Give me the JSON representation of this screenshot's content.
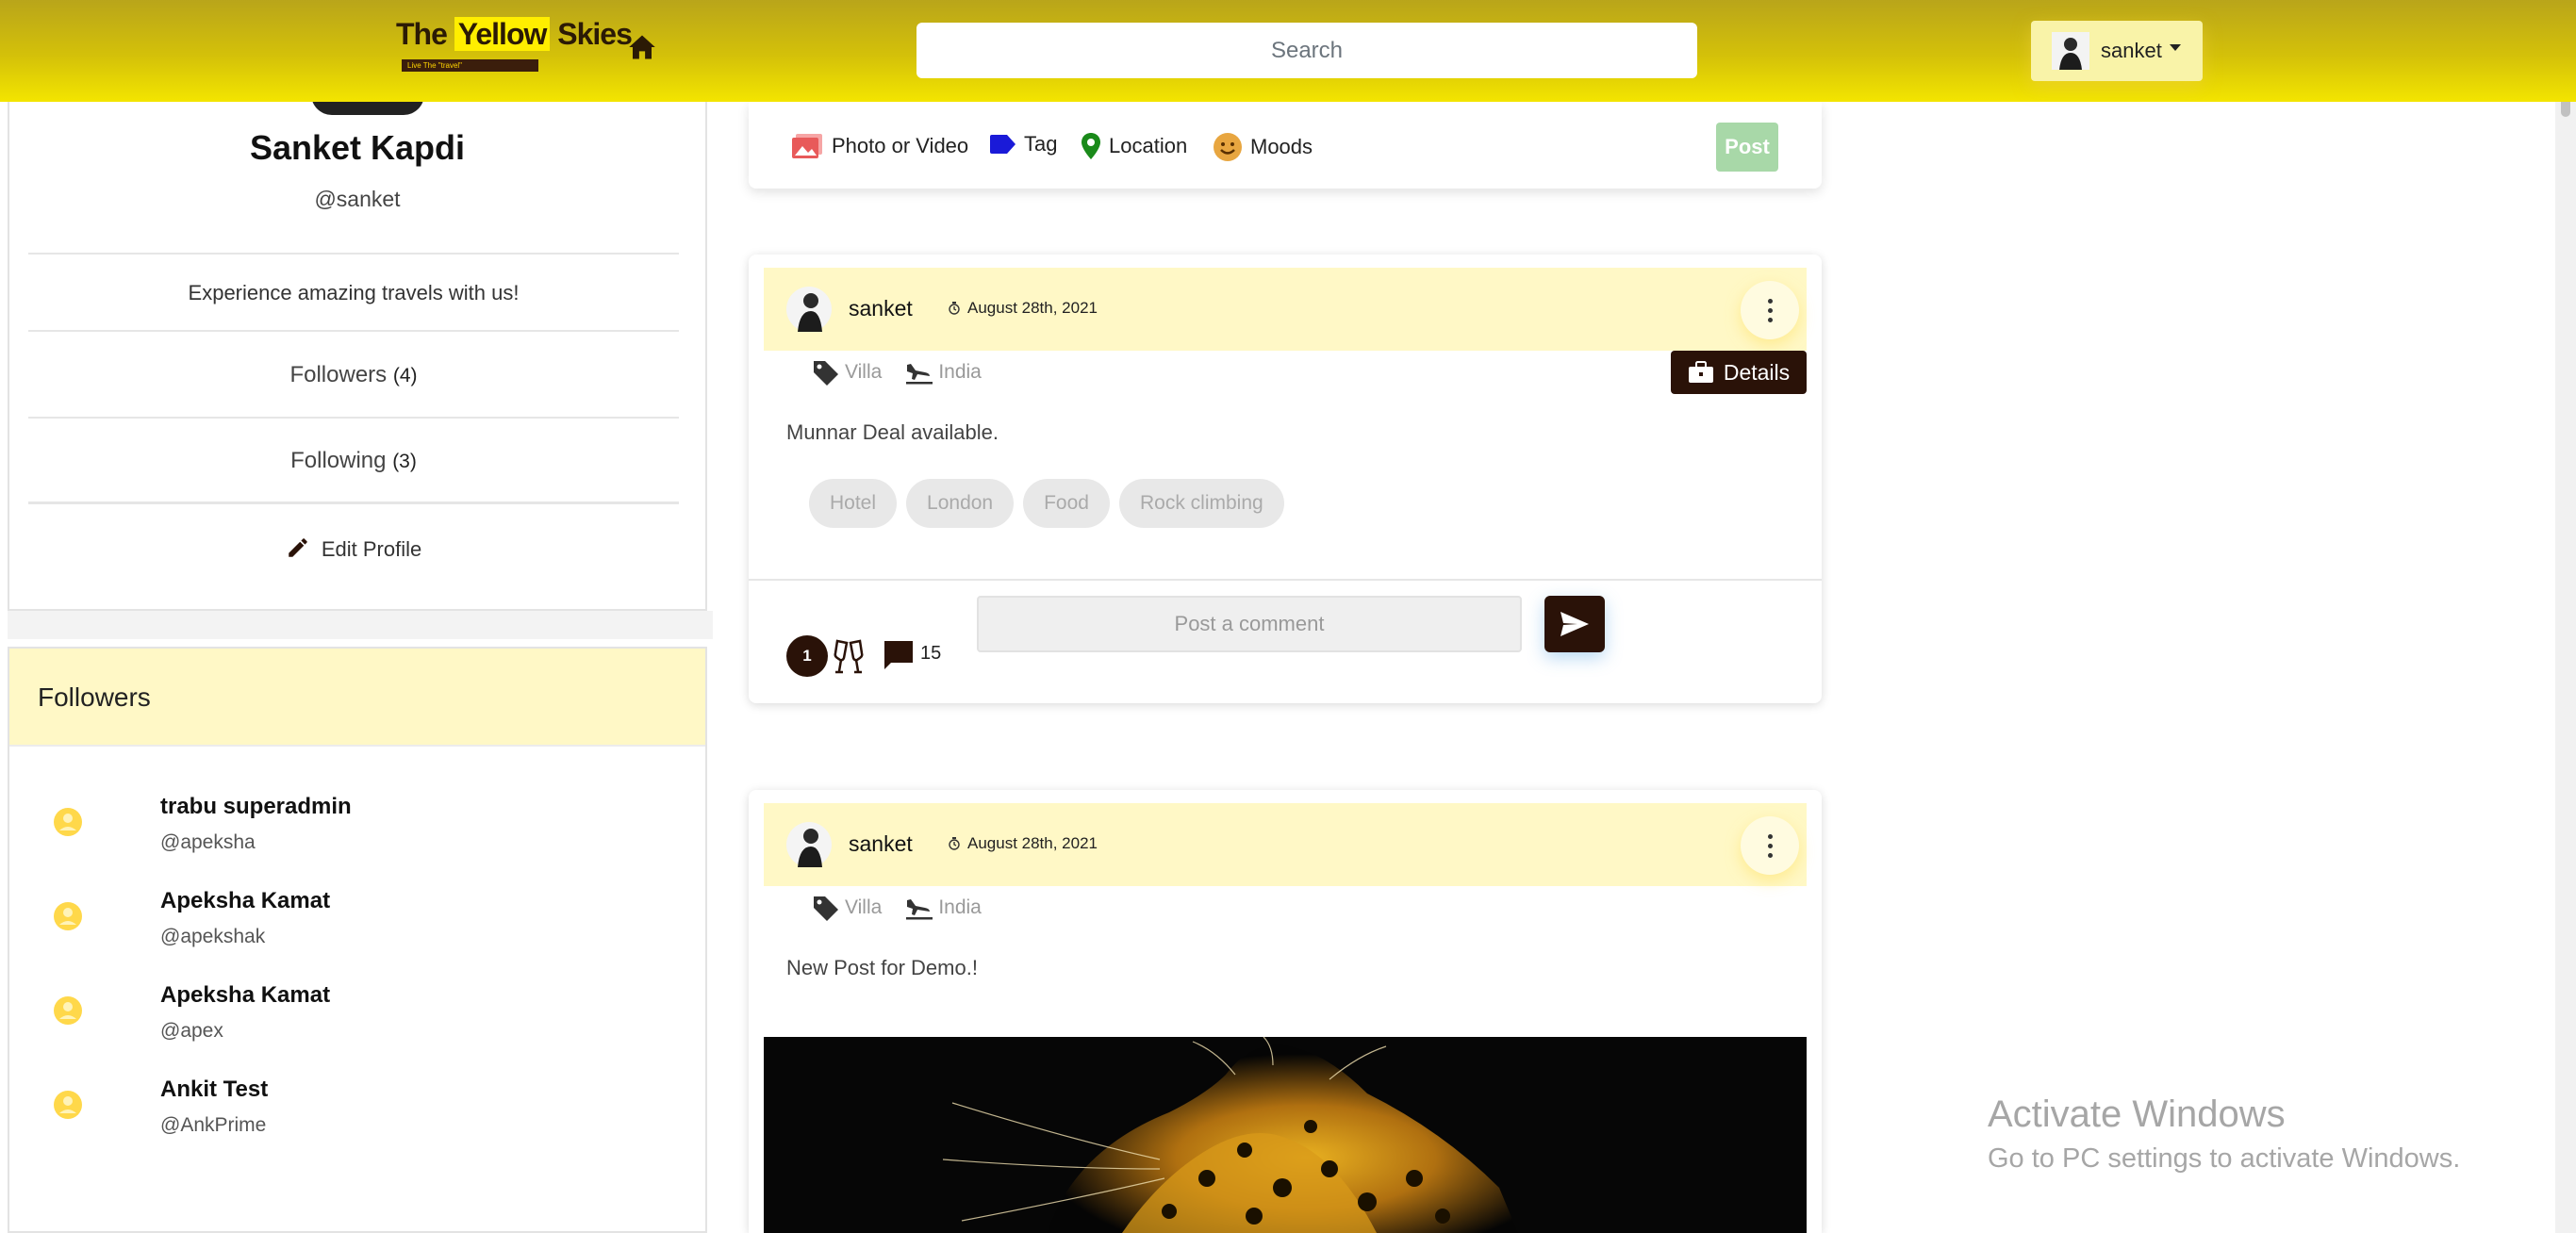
{
  "header": {
    "logo_part1": "The ",
    "logo_highlight": "Yellow",
    "logo_part2": " Skies",
    "logo_tagline": "Live The \"travel\"",
    "search_placeholder": "Search",
    "user_name": "sanket"
  },
  "profile": {
    "name": "Sanket Kapdi",
    "handle": "@sanket",
    "bio": "Experience amazing travels with us!",
    "followers_label": "Followers",
    "followers_count": "(4)",
    "following_label": "Following",
    "following_count": "(3)",
    "edit_label": "Edit Profile"
  },
  "followers": {
    "title": "Followers",
    "items": [
      {
        "name": "trabu superadmin",
        "handle": "@apeksha"
      },
      {
        "name": "Apeksha Kamat",
        "handle": "@apekshak"
      },
      {
        "name": "Apeksha Kamat",
        "handle": "@apex"
      },
      {
        "name": "Ankit Test",
        "handle": "@AnkPrime"
      }
    ]
  },
  "composer": {
    "photo_label": "Photo or Video",
    "tag_label": "Tag",
    "location_label": "Location",
    "moods_label": "Moods",
    "post_label": "Post"
  },
  "posts": [
    {
      "user": "sanket",
      "date": "August 28th, 2021",
      "tag": "Villa",
      "location": "India",
      "details_label": "Details",
      "text": "Munnar Deal available.",
      "tags": [
        "Hotel",
        "London",
        "Food",
        "Rock climbing"
      ],
      "likes": "1",
      "comments": "15",
      "comment_placeholder": "Post a comment"
    },
    {
      "user": "sanket",
      "date": "August 28th, 2021",
      "tag": "Villa",
      "location": "India",
      "text": "New Post for Demo.!"
    }
  ],
  "watermark": {
    "title": "Activate Windows",
    "subtitle": "Go to PC settings to activate Windows."
  },
  "colors": {
    "brand_yellow": "#f3e500",
    "dark_brown": "#2a1208",
    "pale_yellow": "#fff8c6",
    "post_green": "#a8d8a8"
  }
}
